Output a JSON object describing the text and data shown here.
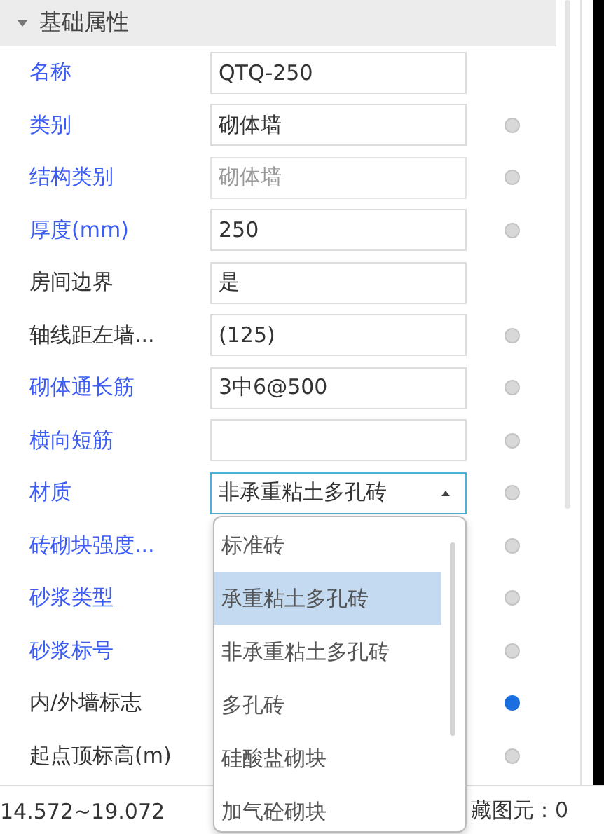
{
  "section": {
    "title": "基础属性",
    "expanded": true
  },
  "rows": [
    {
      "label": "名称",
      "public": true,
      "field": {
        "kind": "text",
        "value": "QTQ-250",
        "disabled": false
      }
    },
    {
      "label": "类别",
      "public": true,
      "field": {
        "kind": "text",
        "value": "砌体墙",
        "disabled": false
      },
      "active": false
    },
    {
      "label": "结构类别",
      "public": true,
      "field": {
        "kind": "text",
        "value": "砌体墙",
        "disabled": true
      },
      "active": false
    },
    {
      "label": "厚度(mm)",
      "public": true,
      "field": {
        "kind": "text",
        "value": "250",
        "disabled": false
      },
      "active": false
    },
    {
      "label": "房间边界",
      "public": false,
      "field": {
        "kind": "text",
        "value": "是",
        "disabled": false
      }
    },
    {
      "label": "轴线距左墙...",
      "public": false,
      "field": {
        "kind": "text",
        "value": "(125)",
        "disabled": false
      },
      "active": false
    },
    {
      "label": "砌体通长筋",
      "public": true,
      "field": {
        "kind": "text",
        "value": "3中6@500",
        "disabled": false
      },
      "active": false
    },
    {
      "label": "横向短筋",
      "public": true,
      "field": {
        "kind": "text"
      },
      "active": false
    },
    {
      "label": "材质",
      "public": true,
      "field": {
        "kind": "dropdown",
        "value": "非承重粘土多孔砖",
        "open": true,
        "disabled": false
      },
      "active": false
    },
    {
      "label": "砖砌块强度...",
      "public": true,
      "active": false
    },
    {
      "label": "砂浆类型",
      "public": true,
      "active": false
    },
    {
      "label": "砂浆标号",
      "public": true,
      "active": false
    },
    {
      "label": "内/外墙标志",
      "public": false,
      "active": true
    },
    {
      "label": "起点顶标高(m)",
      "public": false,
      "active": false
    }
  ],
  "dropdown": {
    "items": [
      {
        "label": "标准砖",
        "selected": false
      },
      {
        "label": "承重粘土多孔砖",
        "selected": true
      },
      {
        "label": "非承重粘土多孔砖",
        "selected": false
      },
      {
        "label": "多孔砖",
        "selected": false
      },
      {
        "label": "硅酸盐砌块",
        "selected": false
      },
      {
        "label": "加气砼砌块",
        "selected": false
      }
    ]
  },
  "status_bar": [
    "14.572~19.072",
    "藏图元：0"
  ]
}
